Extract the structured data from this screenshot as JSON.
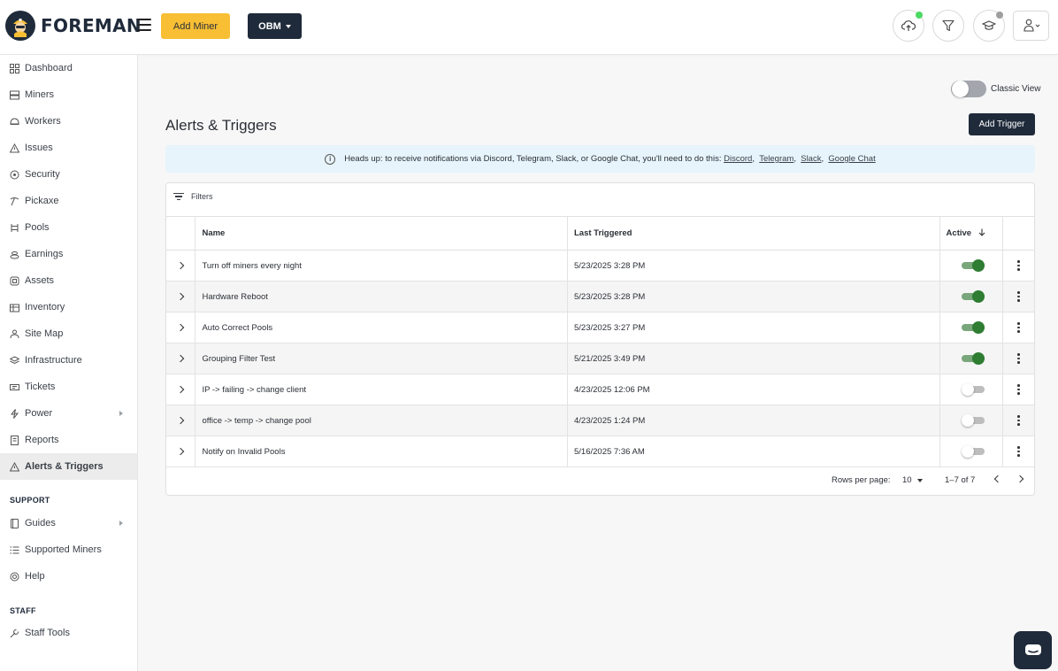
{
  "brand": {
    "name": "FOREMAN"
  },
  "topbar": {
    "add_miner_label": "Add Miner",
    "org_label": "OBM",
    "icons": [
      "cloud-upload-icon",
      "filter-icon",
      "graduation-cap-icon",
      "user-icon"
    ],
    "colors": {
      "accent": "#f8bf35",
      "navy": "#1f2a3a",
      "status_online": "#4cd964",
      "status_idle": "#9e9e9e"
    }
  },
  "sidebar": {
    "items": [
      {
        "label": "Dashboard",
        "icon": "dashboard-icon"
      },
      {
        "label": "Miners",
        "icon": "server-icon"
      },
      {
        "label": "Workers",
        "icon": "hard-hat-icon"
      },
      {
        "label": "Issues",
        "icon": "warning-icon"
      },
      {
        "label": "Security",
        "icon": "shield-icon"
      },
      {
        "label": "Pickaxe",
        "icon": "pickaxe-icon"
      },
      {
        "label": "Pools",
        "icon": "pools-icon"
      },
      {
        "label": "Earnings",
        "icon": "coins-icon"
      },
      {
        "label": "Assets",
        "icon": "assets-icon"
      },
      {
        "label": "Inventory",
        "icon": "inventory-icon"
      },
      {
        "label": "Site Map",
        "icon": "site-map-icon"
      },
      {
        "label": "Infrastructure",
        "icon": "layers-icon"
      },
      {
        "label": "Tickets",
        "icon": "ticket-icon"
      },
      {
        "label": "Power",
        "icon": "bolt-icon"
      },
      {
        "label": "Reports",
        "icon": "report-icon"
      },
      {
        "label": "Alerts & Triggers",
        "icon": "alert-icon"
      }
    ],
    "support_title": "SUPPORT",
    "support_items": [
      {
        "label": "Guides",
        "icon": "book-icon"
      },
      {
        "label": "Supported Miners",
        "icon": "list-icon"
      },
      {
        "label": "Help",
        "icon": "help-icon"
      }
    ],
    "staff_title": "STAFF",
    "staff_items": [
      {
        "label": "Staff Tools",
        "icon": "tools-icon"
      }
    ]
  },
  "main": {
    "classic_view_label": "Classic View",
    "classic_view_on": false,
    "title": "Alerts & Triggers",
    "add_trigger_label": "Add Trigger",
    "banner": {
      "text": "Heads up: to receive notifications via Discord, Telegram, Slack, or Google Chat, you'll need to do this:",
      "links": [
        "Discord",
        "Telegram",
        "Slack",
        "Google Chat"
      ]
    },
    "filters_label": "Filters",
    "table": {
      "headers": {
        "name": "Name",
        "last": "Last Triggered",
        "active": "Active"
      },
      "rows": [
        {
          "name": "Turn off miners every night",
          "last": "5/23/2025 3:28 PM",
          "active": true
        },
        {
          "name": "Hardware Reboot",
          "last": "5/23/2025 3:28 PM",
          "active": true
        },
        {
          "name": "Auto Correct Pools",
          "last": "5/23/2025 3:27 PM",
          "active": true
        },
        {
          "name": "Grouping Filter Test",
          "last": "5/21/2025 3:49 PM",
          "active": true
        },
        {
          "name": "IP -> failing -> change client",
          "last": "4/23/2025 12:06 PM",
          "active": false
        },
        {
          "name": "office -> temp -> change pool",
          "last": "4/23/2025 1:24 PM",
          "active": false
        },
        {
          "name": "Notify on Invalid Pools",
          "last": "5/16/2025 7:36 AM",
          "active": false
        }
      ]
    },
    "pagination": {
      "rows_per_page_label": "Rows per page:",
      "rows_per_page": "10",
      "range": "1–7 of 7"
    }
  }
}
